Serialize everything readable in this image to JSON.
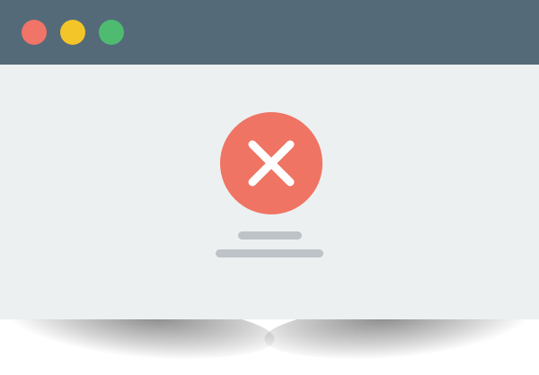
{
  "window": {
    "titlebar_color": "#546a79",
    "content_background": "#ecf0f1",
    "controls": [
      {
        "name": "close",
        "color": "#f07467"
      },
      {
        "name": "minimize",
        "color": "#f4c528"
      },
      {
        "name": "maximize",
        "color": "#4ebb71"
      }
    ]
  },
  "error": {
    "icon": "x-mark-icon",
    "circle_color": "#ef7463",
    "mark_color": "#ffffff",
    "placeholder_lines": 2,
    "placeholder_color": "#bdc3c7"
  }
}
